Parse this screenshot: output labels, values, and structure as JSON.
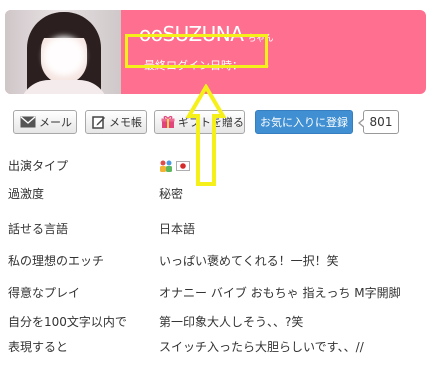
{
  "profile": {
    "name": "ooSUZUNA",
    "name_suffix": "ちゃん",
    "last_login_label": "最終ログイン日時：",
    "last_login_value": "----",
    "header_color": "#ff6f8f"
  },
  "actions": {
    "mail_label": "メール",
    "memo_label": "メモ帳",
    "gift_label": "ギフトを贈る",
    "favorite_label": "お気に入りに登録",
    "favorite_count": "801",
    "favorite_color": "#3f8fd2"
  },
  "annotation": {
    "color": "#f6f01a"
  },
  "info": {
    "rows": [
      {
        "label": "出演タイプ",
        "value": ""
      },
      {
        "label": "過激度",
        "value": "秘密"
      },
      {
        "label": "話せる言語",
        "value": "日本語"
      },
      {
        "label": "私の理想のエッチ",
        "value": "いっぱい褒めてくれる！一択！笑"
      },
      {
        "label": "得意なプレイ",
        "value": "オナニー バイブ おもちゃ 指えっち M字開脚"
      },
      {
        "label_lines": [
          "自分を100文字以内で",
          "表現すると"
        ],
        "value_lines": [
          "第一印象大人しそう、、?笑",
          "スイッチ入ったら大胆らしいです、、//"
        ]
      }
    ],
    "type_icons": [
      "group-icon",
      "japan-flag-icon"
    ]
  }
}
